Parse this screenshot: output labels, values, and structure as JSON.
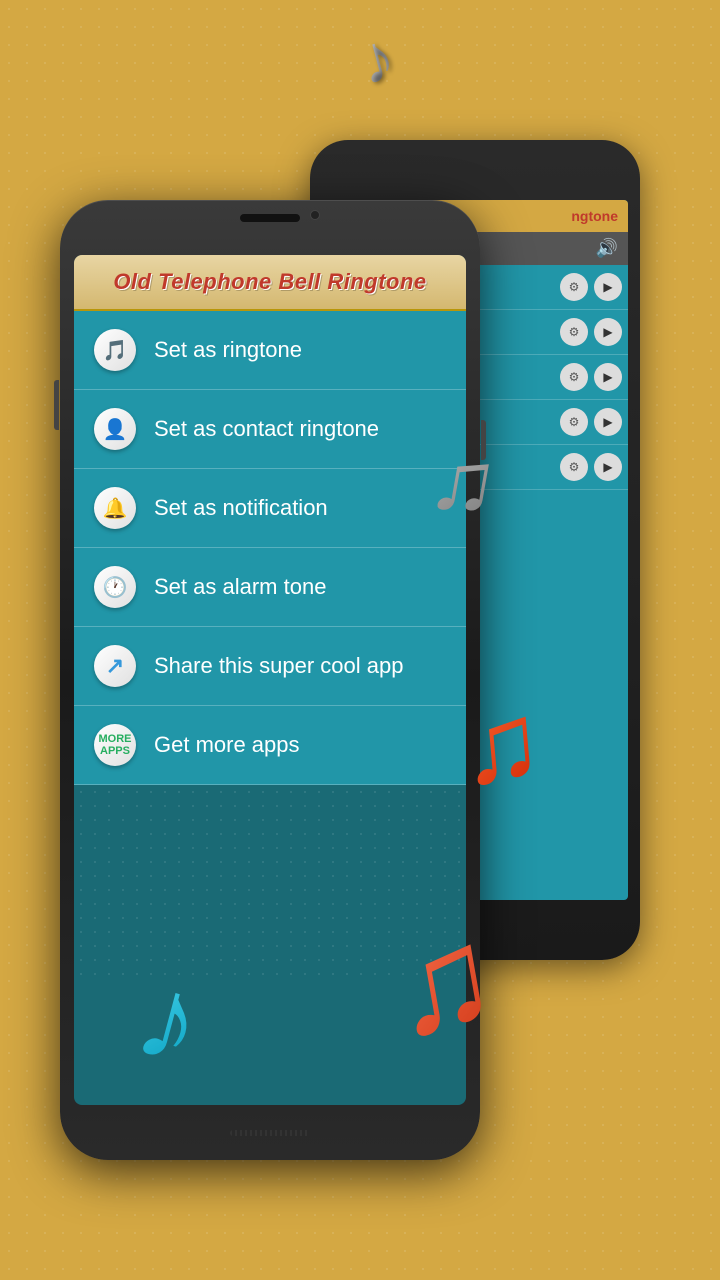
{
  "app": {
    "title": "Old Telephone Bell Ringtone",
    "background_color": "#d4a843"
  },
  "menu_items": [
    {
      "id": "set-ringtone",
      "label": "Set as ringtone",
      "icon": "🎵",
      "icon_color": "#e74c3c"
    },
    {
      "id": "set-contact-ringtone",
      "label": "Set as contact ringtone",
      "icon": "👤",
      "icon_color": "#3498db"
    },
    {
      "id": "set-notification",
      "label": "Set as notification",
      "icon": "⏰",
      "icon_color": "#e74c3c"
    },
    {
      "id": "set-alarm-tone",
      "label": "Set as alarm tone",
      "icon": "🕐",
      "icon_color": "#27ae60"
    },
    {
      "id": "share-app",
      "label": "Share this super cool app",
      "icon": "↗",
      "icon_color": "#3498db"
    },
    {
      "id": "get-more-apps",
      "label": "Get more apps",
      "icon": "📱",
      "icon_color": "#27ae60"
    }
  ],
  "back_phone": {
    "header_text": "ngtone",
    "rows": 5
  },
  "notes": {
    "silver_top": "♪",
    "silver_mid": "♫",
    "red": "♫",
    "blue": "♪",
    "red_2": "♫"
  }
}
